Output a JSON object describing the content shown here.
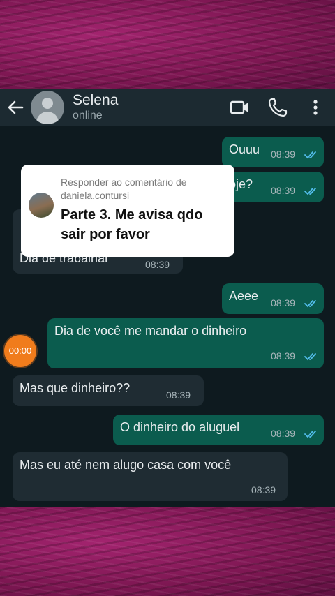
{
  "contact": {
    "name": "Selena",
    "status": "online"
  },
  "icons": {
    "back": "arrow-left-icon",
    "avatar": "default-avatar-icon",
    "video": "video-call-icon",
    "phone": "phone-call-icon",
    "menu": "more-vertical-icon",
    "read": "double-check-icon"
  },
  "colors": {
    "outgoing_bubble": "#0b5c4e",
    "incoming_bubble": "#1f2c33",
    "chat_background": "#0e1a1f",
    "header": "#1c2a31",
    "read_ticks": "#53bdeb",
    "timer": "#f07c1c",
    "frame": "#8a1a5c"
  },
  "messages": [
    {
      "text": "Ouuu",
      "time": "08:39",
      "direction": "out"
    },
    {
      "text": "oje?",
      "time": "08:39",
      "direction": "out"
    },
    {
      "text": "Dia de trabalhar",
      "time": "08:39",
      "direction": "in"
    },
    {
      "text": "Aeee",
      "time": "08:39",
      "direction": "out"
    },
    {
      "text": "Dia de você me mandar o dinheiro",
      "time": "08:39",
      "direction": "out"
    },
    {
      "text": "Mas que dinheiro??",
      "time": "08:39",
      "direction": "in"
    },
    {
      "text": "O dinheiro do aluguel",
      "time": "08:39",
      "direction": "out"
    },
    {
      "text": "Mas eu até nem alugo casa com você",
      "time": "08:39",
      "direction": "in"
    }
  ],
  "comment_overlay": {
    "label": "Responder ao comentário de daniela.contursi",
    "text": "Parte 3. Me avisa qdo sair por favor"
  },
  "timer": {
    "label": "00:00"
  }
}
